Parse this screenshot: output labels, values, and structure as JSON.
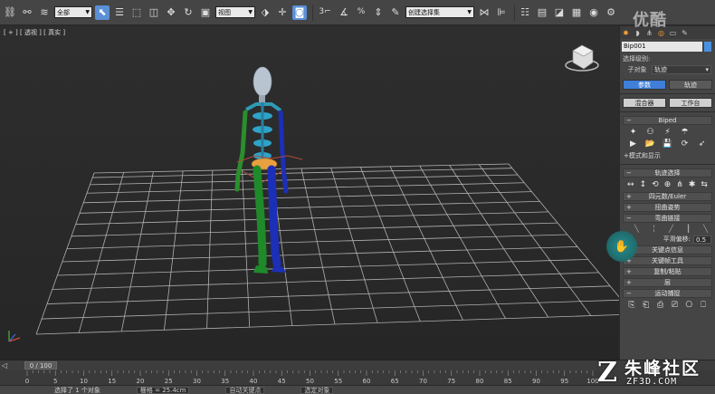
{
  "toolbar": {
    "selection_filter": "全部",
    "ref_coord": "视图",
    "named_sel_placeholder": "创建选择集",
    "snap_number": "3",
    "percent_snap": "%"
  },
  "viewport": {
    "label": "[ + ] [ 透视 ] [ 真实 ]"
  },
  "panel": {
    "object_name": "Bip001",
    "selection_level_label": "选择级别:",
    "sublevel_label": "子对象",
    "sublevel_value": "轨迹",
    "btn_params": "参数",
    "btn_track": "轨迹",
    "btn_mixer": "混合器",
    "btn_workbench": "工作台",
    "rollout_biped": "Biped",
    "mode_display": "+模式和显示",
    "rollout_track_select": "轨迹选择",
    "rollout_quat_euler": "四元数/Euler",
    "rollout_twist_pose": "扭曲姿势",
    "rollout_bend_links": "弯曲链接",
    "smooth_offset_label": "平滑偏移:",
    "smooth_offset_value": "0.5",
    "rollout_key_info": "关键点信息",
    "rollout_key_tools": "关键帧工具",
    "rollout_copy_paste": "复制/粘贴",
    "rollout_layers": "层",
    "rollout_motion_capture": "运动捕捉"
  },
  "timeline": {
    "frame_display": "0 / 100",
    "ticks": [
      "0",
      "5",
      "10",
      "15",
      "20",
      "25",
      "30",
      "35",
      "40",
      "45",
      "50",
      "55",
      "60",
      "65",
      "70",
      "75",
      "80",
      "85",
      "90",
      "95",
      "100"
    ]
  },
  "status": {
    "selected_text": "选择了 1 个对象",
    "grid_text": "栅格 = 25.4cm",
    "auto_key": "自动关键点",
    "selected_obj": "选定对象"
  },
  "watermark": {
    "top": "优酷",
    "brand_cn": "朱峰社区",
    "brand_url": "ZF3D.COM",
    "brand_z": "Z"
  },
  "colors": {
    "accent_blue": "#3f7fd8",
    "spine_cyan": "#2ea3c9",
    "leg_blue": "#1c2fb8",
    "leg_green": "#1f8a2a",
    "pelvis_orange": "#e8a040"
  }
}
